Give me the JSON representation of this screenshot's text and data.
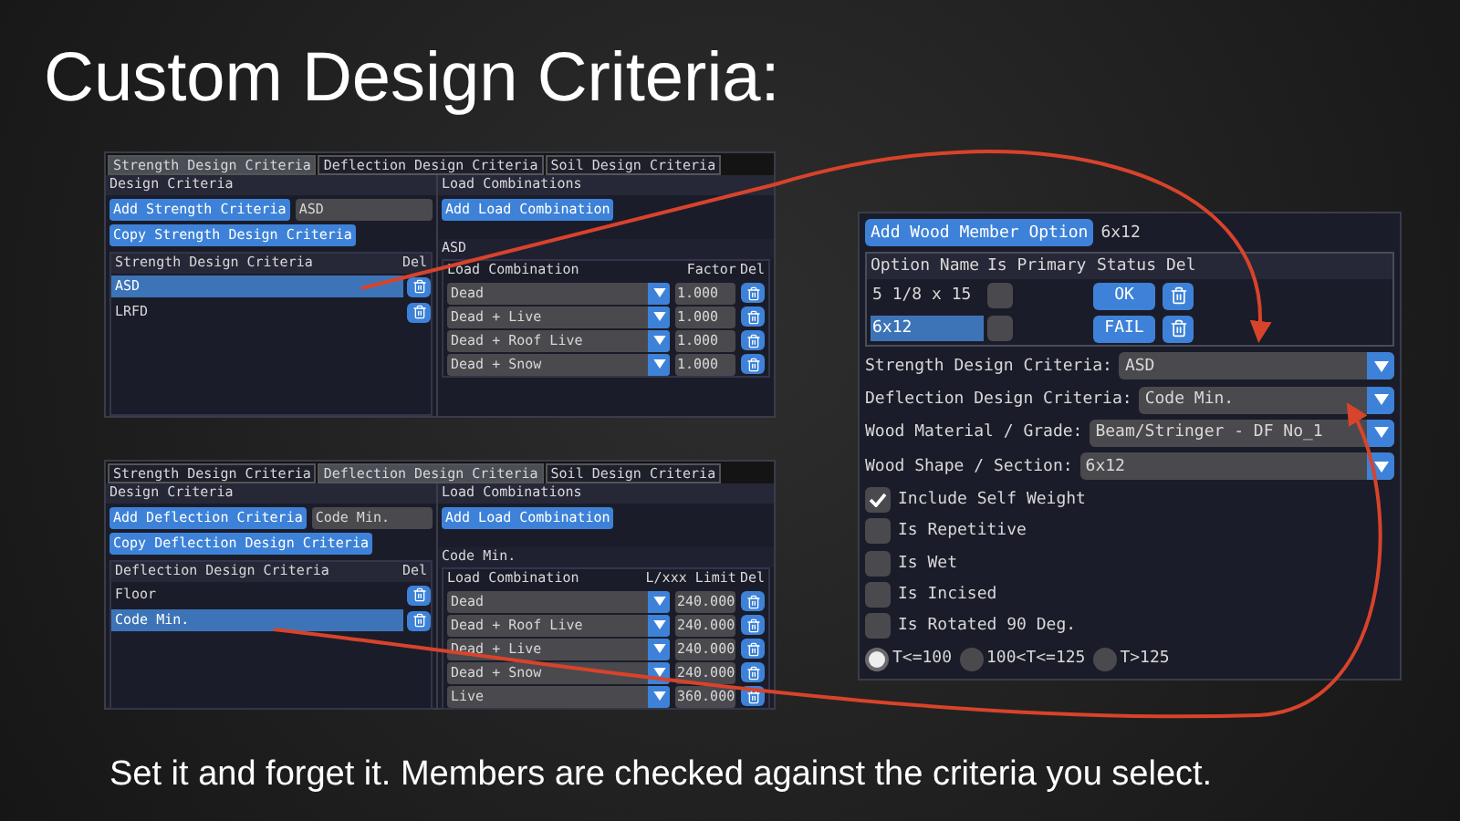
{
  "slide_title": "Custom Design Criteria:",
  "panels": [
    {
      "tabs": [
        {
          "label": "Strength Design Criteria",
          "selected": true
        },
        {
          "label": "Deflection Design Criteria",
          "selected": false
        },
        {
          "label": "Soil Design Criteria",
          "selected": false
        }
      ],
      "left": {
        "title": "Design Criteria",
        "add_button": "Add Strength Criteria",
        "name_field": "ASD",
        "copy_button": "Copy Strength Design Criteria",
        "list_header": "Strength Design Criteria",
        "del_header": "Del",
        "items": [
          {
            "label": "ASD",
            "selected": true
          },
          {
            "label": "LRFD",
            "selected": false
          }
        ]
      },
      "right": {
        "title": "Load Combinations",
        "add_button": "Add Load Combination",
        "table_title": "ASD",
        "columns": [
          "Load Combination",
          "Factor",
          "Del"
        ],
        "rows": [
          {
            "combo": "Dead",
            "value": "1.000"
          },
          {
            "combo": "Dead + Live",
            "value": "1.000"
          },
          {
            "combo": "Dead + Roof Live",
            "value": "1.000"
          },
          {
            "combo": "Dead + Snow",
            "value": "1.000"
          }
        ]
      }
    },
    {
      "tabs": [
        {
          "label": "Strength Design Criteria",
          "selected": false
        },
        {
          "label": "Deflection Design Criteria",
          "selected": true
        },
        {
          "label": "Soil Design Criteria",
          "selected": false
        }
      ],
      "left": {
        "title": "Design Criteria",
        "add_button": "Add Deflection Criteria",
        "name_field": "Code Min.",
        "copy_button": "Copy Deflection Design Criteria",
        "list_header": "Deflection Design Criteria",
        "del_header": "Del",
        "items": [
          {
            "label": "Floor",
            "selected": false
          },
          {
            "label": "Code Min.",
            "selected": true
          }
        ]
      },
      "right": {
        "title": "Load Combinations",
        "add_button": "Add Load Combination",
        "table_title": "Code Min.",
        "columns": [
          "Load Combination",
          "L/xxx Limit",
          "Del"
        ],
        "rows": [
          {
            "combo": "Dead",
            "value": "240.000"
          },
          {
            "combo": "Dead + Roof Live",
            "value": "240.000"
          },
          {
            "combo": "Dead + Live",
            "value": "240.000"
          },
          {
            "combo": "Dead + Snow",
            "value": "240.000"
          },
          {
            "combo": "Live",
            "value": "360.000"
          }
        ]
      }
    }
  ],
  "member": {
    "add_button": "Add Wood Member Option",
    "option_name": "6x12",
    "columns": [
      "Option Name",
      "Is Primary",
      "Status",
      "Del"
    ],
    "options": [
      {
        "name": "5 1/8 x 15",
        "selected": false,
        "primary": false,
        "status": "OK"
      },
      {
        "name": "6x12",
        "selected": true,
        "primary": false,
        "status": "FAIL"
      }
    ],
    "fields": [
      {
        "label": "Strength Design Criteria:",
        "value": "ASD"
      },
      {
        "label": "Deflection Design Criteria:",
        "value": "Code Min."
      },
      {
        "label": "Wood Material / Grade:",
        "value": "Beam/Stringer - DF No_1"
      },
      {
        "label": "Wood Shape / Section:",
        "value": "6x12"
      }
    ],
    "checkboxes": [
      {
        "label": "Include Self Weight",
        "checked": true
      },
      {
        "label": "Is Repetitive",
        "checked": false
      },
      {
        "label": "Is Wet",
        "checked": false
      },
      {
        "label": "Is Incised",
        "checked": false
      },
      {
        "label": "Is Rotated 90 Deg.",
        "checked": false
      }
    ],
    "radios": [
      {
        "label": "T<=100",
        "selected": true
      },
      {
        "label": "100<T<=125",
        "selected": false
      },
      {
        "label": "T>125",
        "selected": false
      }
    ]
  },
  "caption": "Set it and forget it.  Members are checked against the criteria you select."
}
